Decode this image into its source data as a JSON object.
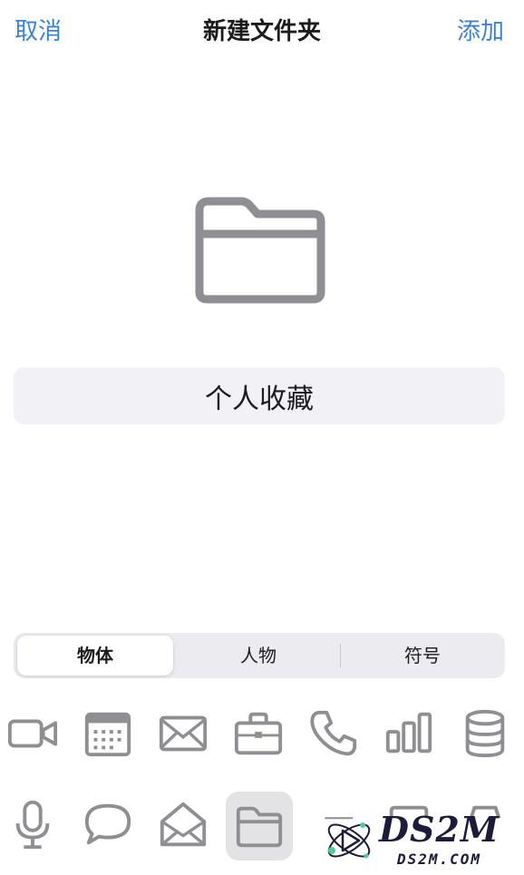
{
  "nav": {
    "cancel_label": "取消",
    "title": "新建文件夹",
    "add_label": "添加"
  },
  "folder_name": {
    "value": "个人收藏"
  },
  "segments": {
    "items": [
      "物体",
      "人物",
      "符号"
    ],
    "selected": "物体"
  },
  "icons": {
    "row1": [
      "video-icon",
      "calendar-icon",
      "envelope-icon",
      "briefcase-icon",
      "phone-icon",
      "bar-chart-icon",
      "cylinder-icon"
    ],
    "row2": [
      "microphone-icon",
      "speech-bubble-icon",
      "envelope-open-icon",
      "folder-icon",
      "tray-icon",
      "printer-icon",
      "archive-icon"
    ],
    "selected": "folder-icon"
  },
  "watermark": {
    "text": "DS2M",
    "subtext": "DS2M.COM"
  },
  "colors": {
    "accent": "#3a82d8",
    "icon_gray": "#8e8e93",
    "field_bg": "#f1f1f6",
    "selected_icon_bg": "#e3e3e6"
  }
}
